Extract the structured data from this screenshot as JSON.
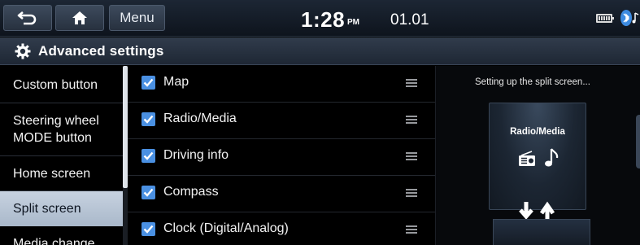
{
  "topbar": {
    "back_icon": "back-arrow-icon",
    "home_icon": "home-icon",
    "menu_label": "Menu",
    "time": "1:28",
    "ampm": "PM",
    "date": "01.01",
    "status_icons": [
      "battery-icon",
      "bluetooth-icon"
    ]
  },
  "titlebar": {
    "icon": "gear-icon",
    "title": "Advanced settings"
  },
  "sidebar": {
    "items": [
      {
        "label": "Custom button",
        "selected": false
      },
      {
        "label": "Steering wheel MODE button",
        "selected": false
      },
      {
        "label": "Home screen",
        "selected": false
      },
      {
        "label": "Split screen",
        "selected": true
      },
      {
        "label": "Media change",
        "selected": false
      }
    ]
  },
  "list": {
    "items": [
      {
        "label": "Map",
        "checked": true
      },
      {
        "label": "Radio/Media",
        "checked": true
      },
      {
        "label": "Driving info",
        "checked": true
      },
      {
        "label": "Compass",
        "checked": true
      },
      {
        "label": "Clock (Digital/Analog)",
        "checked": true
      }
    ]
  },
  "preview": {
    "caption": "Setting up the split screen...",
    "card_label": "Radio/Media",
    "icons": [
      "radio-icon",
      "music-note-icon",
      "swap-arrows-icon"
    ]
  },
  "colors": {
    "accent": "#4a90e2",
    "selected_bg": "#b9c6d6",
    "topbar_bg": "#161e29"
  }
}
